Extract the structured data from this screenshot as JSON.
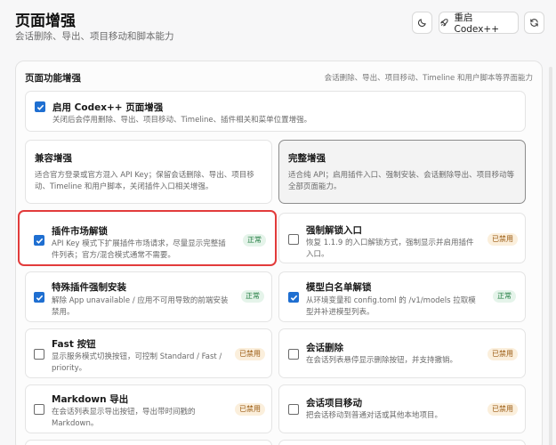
{
  "header": {
    "title": "页面增强",
    "subtitle": "会话删除、导出、项目移动和脚本能力",
    "restart_label": "重启 Codex++"
  },
  "section": {
    "title": "页面功能增强",
    "description": "会话删除、导出、项目移动、Timeline 和用户脚本等界面能力"
  },
  "master": {
    "title": "启用 Codex++ 页面增强",
    "desc": "关闭后会停用删除、导出、项目移动、Timeline、插件相关和菜单位置增强。",
    "checked": true
  },
  "modes": [
    {
      "title": "兼容增强",
      "desc": "适合官方登录或官方混入 API Key；保留会话删除、导出、项目移动、Timeline 和用户脚本，关闭插件入口相关增强。",
      "selected": false
    },
    {
      "title": "完整增强",
      "desc": "适合纯 API；启用插件入口、强制安装、会话删除导出、项目移动等全部页面能力。",
      "selected": true
    }
  ],
  "features": [
    {
      "title": "插件市场解锁",
      "desc": "API Key 模式下扩展插件市场请求，尽量显示完整插件列表；官方/混合模式通常不需要。",
      "badge": "正常",
      "checked": true
    },
    {
      "title": "强制解锁入口",
      "desc": "恢复 1.1.9 的入口解锁方式，强制显示并启用插件入口。",
      "badge": "已禁用",
      "checked": false
    },
    {
      "title": "特殊插件强制安装",
      "desc": "解除 App unavailable / 应用不可用导致的前端安装禁用。",
      "badge": "正常",
      "checked": true
    },
    {
      "title": "模型白名单解锁",
      "desc": "从环境变量和 config.toml 的 /v1/models 拉取模型并补进模型列表。",
      "badge": "正常",
      "checked": true
    },
    {
      "title": "Fast 按钮",
      "desc": "显示服务模式切换按钮，可控制 Standard / Fast / priority。",
      "badge": "已禁用",
      "checked": false
    },
    {
      "title": "会话删除",
      "desc": "在会话列表悬停显示删除按钮，并支持撤销。",
      "badge": "已禁用",
      "checked": false
    },
    {
      "title": "Markdown 导出",
      "desc": "在会话列表显示导出按钮，导出带时间戳的 Markdown。",
      "badge": "已禁用",
      "checked": false
    },
    {
      "title": "会话项目移动",
      "desc": "把会话移动到普通对话或其他本地项目。",
      "badge": "已禁用",
      "checked": false
    }
  ]
}
